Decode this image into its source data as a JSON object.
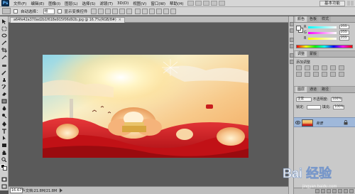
{
  "menubar": {
    "app_logo": "Ps",
    "items": [
      "文件(F)",
      "编辑(E)",
      "图像(I)",
      "图层(L)",
      "选择(S)",
      "滤镜(T)",
      "3D(D)",
      "视图(V)",
      "窗口(W)",
      "帮助(H)"
    ],
    "workspace_label": "基本功能"
  },
  "optbar": {
    "auto_select_label": "自动选择：",
    "auto_select_target": "组",
    "show_transform_label": "显示变换控件"
  },
  "document": {
    "tab_label": "a64fe42a370ad2b1f618e915f06d92b.jpg @ 16.7%(RGB/8#)",
    "close_glyph": "×"
  },
  "status": {
    "zoom": "16.67%",
    "doc_info": "文档:21.8M/21.8M"
  },
  "color_panel": {
    "tabs": [
      "颜色",
      "色板",
      "样式"
    ],
    "sliders": [
      {
        "label": "R",
        "value": "255",
        "color": "#ff3b3b"
      },
      {
        "label": "G",
        "value": "255",
        "color": "#3bd13b"
      },
      {
        "label": "B",
        "value": "255",
        "color": "#3b6bff"
      }
    ]
  },
  "adjustments_panel": {
    "tabs": [
      "调整",
      "蒙版"
    ],
    "label": "添加调整"
  },
  "layers_panel": {
    "tabs": [
      "图层",
      "通道",
      "路径"
    ],
    "blend_mode": "正常",
    "opacity_label": "不透明度:",
    "opacity_value": "100%",
    "lock_label": "锁定:",
    "fill_label": "填充:",
    "fill_value": "100%",
    "layers": [
      {
        "name": "背景",
        "visible": true,
        "locked": true
      }
    ]
  },
  "watermark": {
    "text": "Bai 经验",
    "url": "jingyan.baidu.com"
  },
  "colors": {
    "ui_gray": "#d6d6d6",
    "canvas_bg": "#5a5a5a",
    "selected_layer": "#9fb8da",
    "poster_red": "#c91a1a",
    "poster_gold": "#f0b25a"
  }
}
